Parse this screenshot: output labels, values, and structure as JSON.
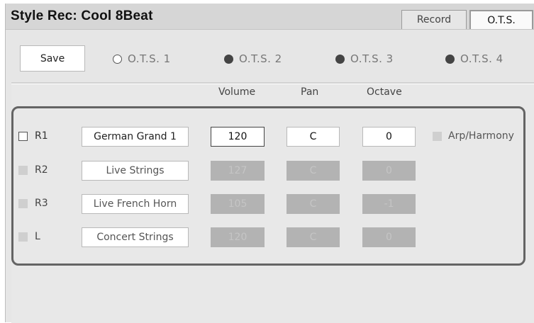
{
  "header": {
    "title": "Style Rec: Cool 8Beat",
    "tabs": [
      {
        "label": "Record",
        "active": false
      },
      {
        "label": "O.T.S.",
        "active": true
      }
    ]
  },
  "toolbar": {
    "save_label": "Save",
    "ots": [
      {
        "label": "O.T.S. 1",
        "state": "empty"
      },
      {
        "label": "O.T.S. 2",
        "state": "filled"
      },
      {
        "label": "O.T.S. 3",
        "state": "filled"
      },
      {
        "label": "O.T.S. 4",
        "state": "filled"
      }
    ]
  },
  "columns": {
    "volume": "Volume",
    "pan": "Pan",
    "octave": "Octave"
  },
  "parts": [
    {
      "label": "R1",
      "checked": true,
      "voice": "German Grand 1",
      "volume": "120",
      "pan": "C",
      "octave": "0",
      "enabled": true
    },
    {
      "label": "R2",
      "checked": false,
      "voice": "Live Strings",
      "volume": "127",
      "pan": "C",
      "octave": "0",
      "enabled": false
    },
    {
      "label": "R3",
      "checked": false,
      "voice": "Live French Horn",
      "volume": "105",
      "pan": "C",
      "octave": "-1",
      "enabled": false
    },
    {
      "label": "L",
      "checked": false,
      "voice": "Concert Strings",
      "volume": "120",
      "pan": "C",
      "octave": "0",
      "enabled": false
    }
  ],
  "arp_harmony": {
    "label": "Arp/Harmony",
    "checked": false
  },
  "colors": {
    "disabled_cell": "#b3b3b3",
    "panel": "#e6e6e6",
    "border": "#646464"
  }
}
